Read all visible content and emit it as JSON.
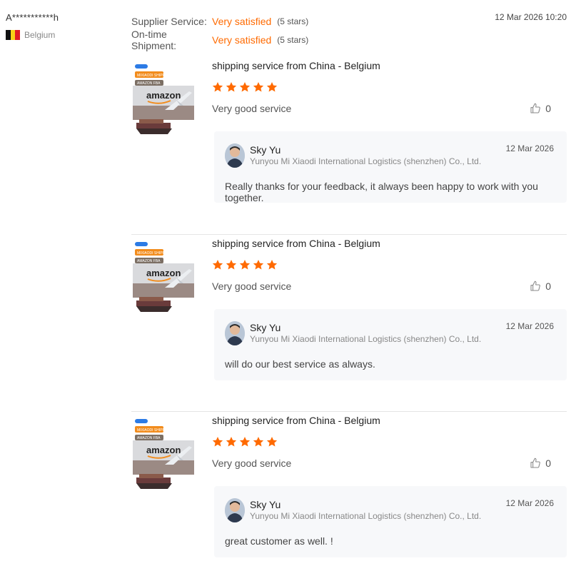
{
  "buyer": {
    "name": "A***********h",
    "country": "Belgium",
    "flag_colors": [
      "#111111",
      "#f7d117",
      "#e01b24"
    ]
  },
  "summary": {
    "date": "12 Mar 2026 10:20",
    "rows": [
      {
        "label": "Supplier Service:",
        "value": "Very satisfied",
        "stars": "(5 stars)"
      },
      {
        "label": "On-time Shipment:",
        "value": "Very satisfied",
        "stars": "(5 stars)"
      }
    ]
  },
  "colors": {
    "accent": "#ff6a00",
    "star": "#ff6a00",
    "reply_bg": "#f7f8fa"
  },
  "reviews": [
    {
      "product_title": "shipping service from China - Belgium",
      "rating": 5,
      "comment": "Very good service",
      "likes": "0",
      "thumbnail": {
        "badge1": "MIXIAODI SHIPPING",
        "badge2": "AMAZON FBA",
        "brand": "amazon"
      },
      "reply": {
        "name": "Sky Yu",
        "company": "Yunyou Mi Xiaodi International Logistics (shenzhen) Co., Ltd.",
        "date": "12 Mar 2026",
        "text": "Really thanks for your feedback, it always been happy to work with you together."
      }
    },
    {
      "product_title": "shipping service from China - Belgium",
      "rating": 5,
      "comment": "Very good service",
      "likes": "0",
      "thumbnail": {
        "badge1": "MIXIAODI SHIPPING",
        "badge2": "AMAZON FBA",
        "brand": "amazon"
      },
      "reply": {
        "name": "Sky Yu",
        "company": "Yunyou Mi Xiaodi International Logistics (shenzhen) Co., Ltd.",
        "date": "12 Mar 2026",
        "text": "will do our best service as always."
      }
    },
    {
      "product_title": "shipping service from China - Belgium",
      "rating": 5,
      "comment": "Very good service",
      "likes": "0",
      "thumbnail": {
        "badge1": "MIXIAODI SHIPPING",
        "badge2": "AMAZON FBA",
        "brand": "amazon"
      },
      "reply": {
        "name": "Sky Yu",
        "company": "Yunyou Mi Xiaodi International Logistics (shenzhen) Co., Ltd.",
        "date": "12 Mar 2026",
        "text": "great customer as well. !"
      }
    }
  ]
}
